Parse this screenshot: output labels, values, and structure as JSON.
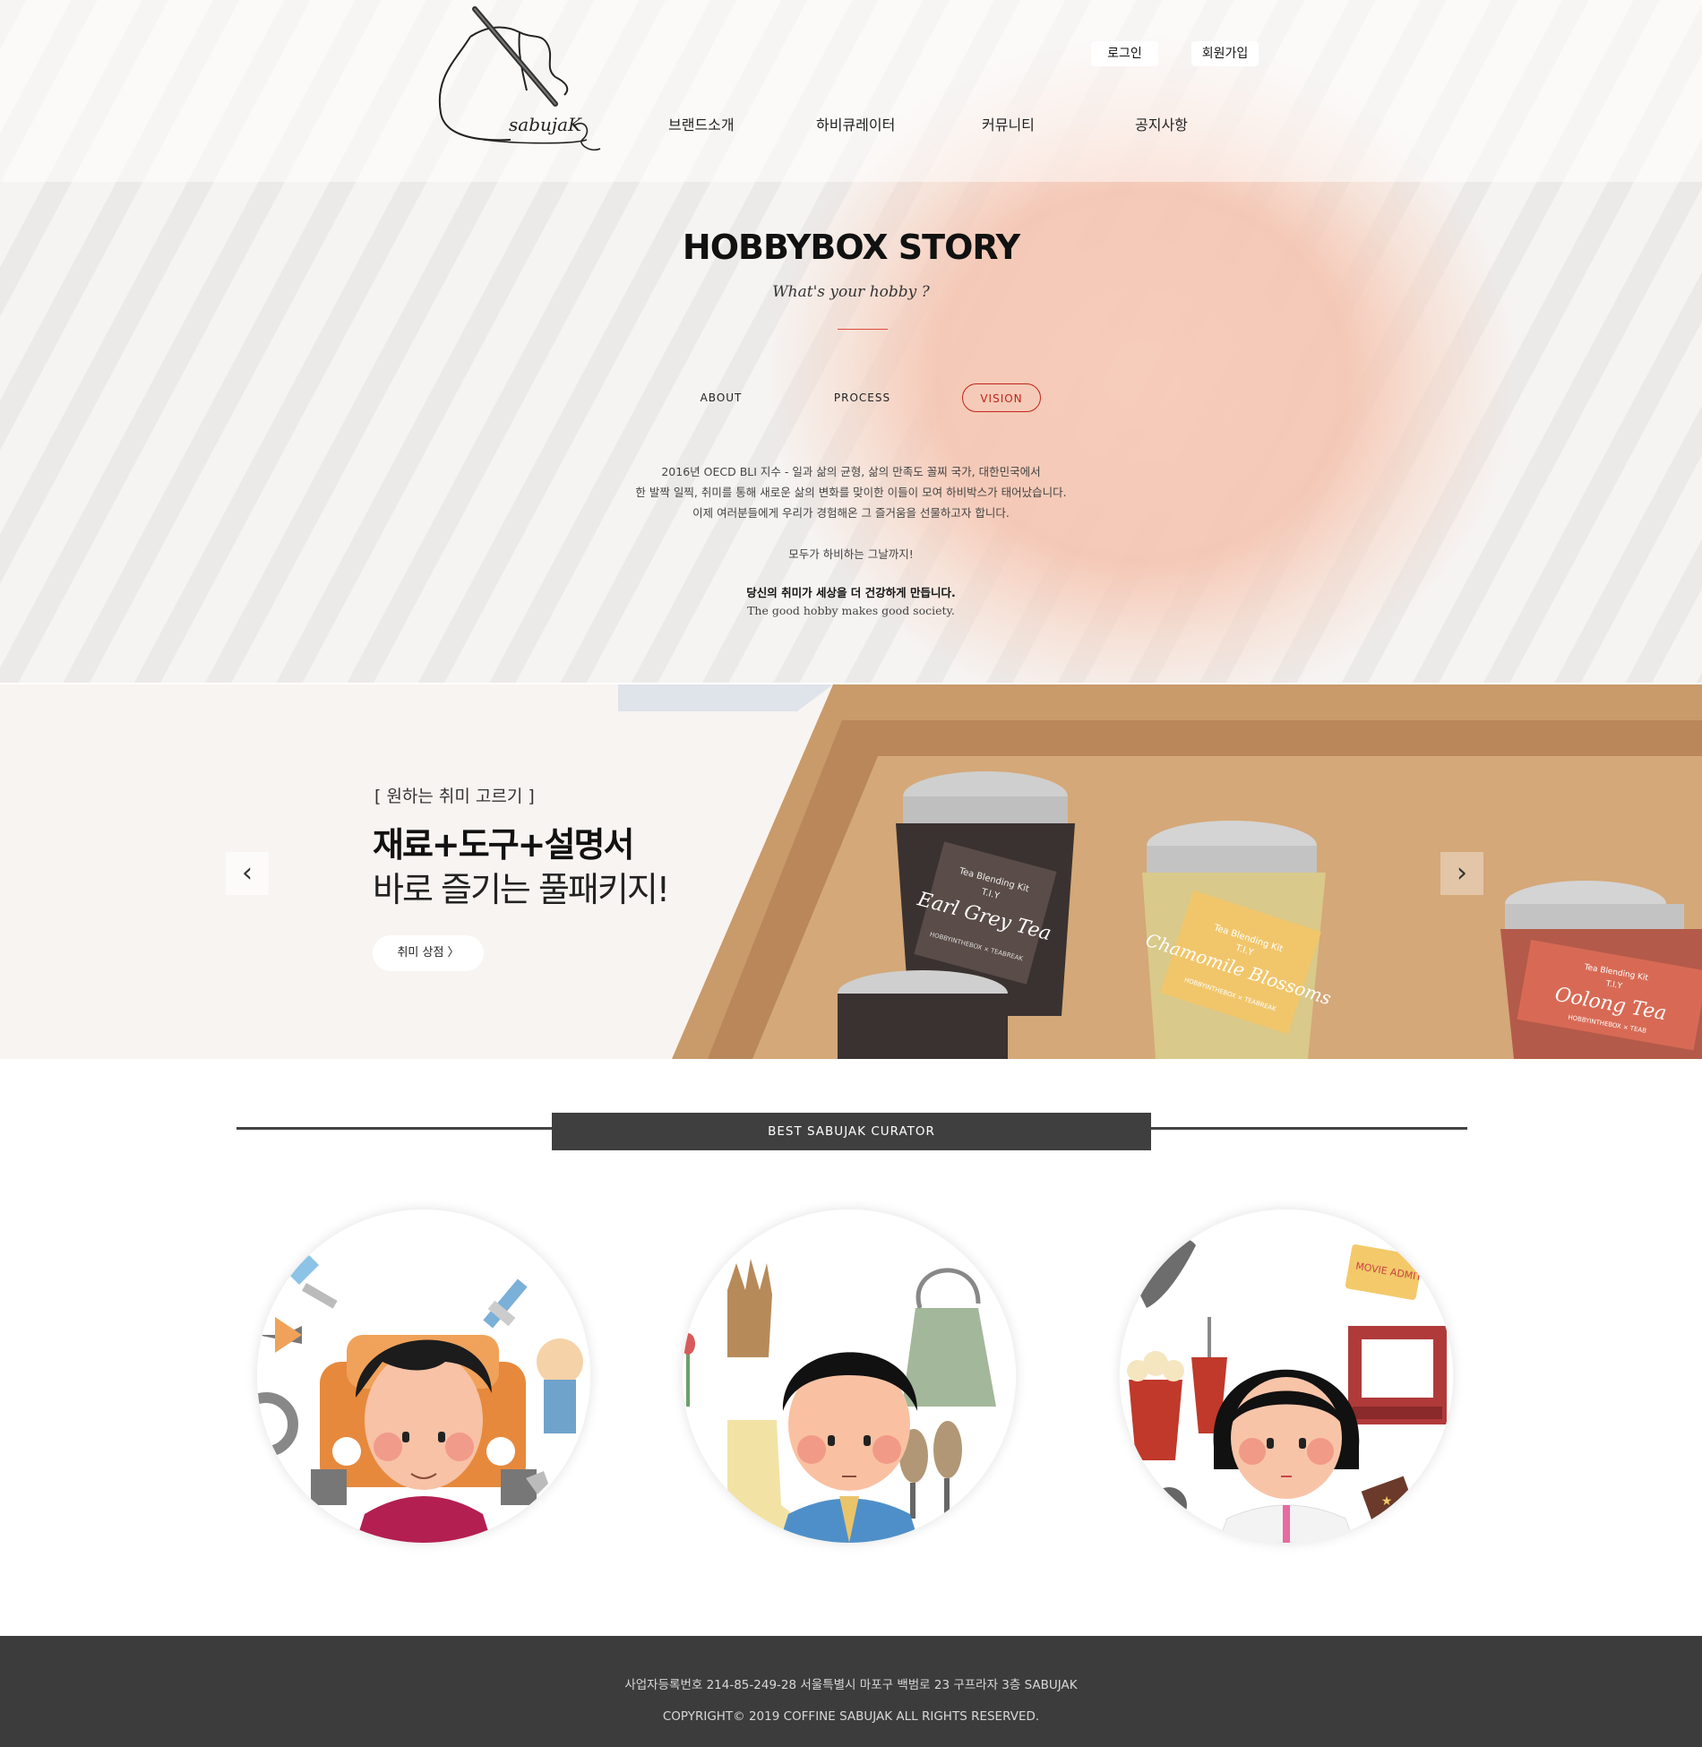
{
  "header": {
    "auth": {
      "login": "로그인",
      "signup": "회원가입"
    },
    "nav": [
      "브랜드소개",
      "하비큐레이터",
      "커뮤니티",
      "공지사항"
    ],
    "logo_text": "sabujaK"
  },
  "story": {
    "title": "HOBBYBOX STORY",
    "subtitle": "What's your hobby ?",
    "tabs": [
      "ABOUT",
      "PROCESS",
      "VISION"
    ],
    "active_tab": "VISION",
    "vision_lines": [
      "2016년 OECD BLI 지수 - 일과 삶의 균형, 삶의 만족도 꼴찌 국가, 대한민국에서",
      "한 발짝 일찍, 취미를 통해 새로운 삶의 변화를 맞이한 이들이 모여 하비박스가 태어났습니다.",
      "이제 여러분들에게 우리가 경험해온 그 즐거움을 선물하고자 합니다.",
      "모두가 하비하는 그날까지!",
      "당신의 취미가 세상을 더 건강하게 만듭니다.",
      "The good hobby makes good society."
    ]
  },
  "banner": {
    "tag": "[ 원하는 취미 고르기 ]",
    "headline": "재료+도구+설명서",
    "subline": "바로 즐기는 풀패키지!",
    "shop_button": "취미 상점 〉",
    "prev": "‹",
    "next": "›",
    "jars": [
      {
        "name": "Earl Grey Tea",
        "label_top": "Tea Blending Kit",
        "label_mid": "T.I.Y",
        "label_bottom": "HOBBYINTHEBOX × TEABREAK"
      },
      {
        "name": "Chamomile Blossoms",
        "label_top": "Tea Blending Kit",
        "label_mid": "T.I.Y",
        "label_bottom": "HOBBYINTHEBOX × TEABREAK"
      },
      {
        "name": "Oolong Tea",
        "label_top": "Tea Blending Kit",
        "label_mid": "T.I.Y",
        "label_bottom": "HOBBYINTHEBOX × TEAB"
      }
    ]
  },
  "curator": {
    "label": "BEST SABUJAK CURATOR",
    "ticket_text": "MOVIE ADMIT"
  },
  "footer": {
    "line1": "사업자등록번호 214-85-249-28 서울특별시 마포구 백범로 23 구프라자 3층 SABUJAK",
    "line2": "COPYRIGHT© 2019 COFFINE SABUJAK ALL RIGHTS RESERVED."
  },
  "colors": {
    "accent_red": "#c0241a",
    "footer_bg": "#3c3c3c",
    "curator_bar": "#3f3f3f",
    "yarn": "#e8804f"
  }
}
